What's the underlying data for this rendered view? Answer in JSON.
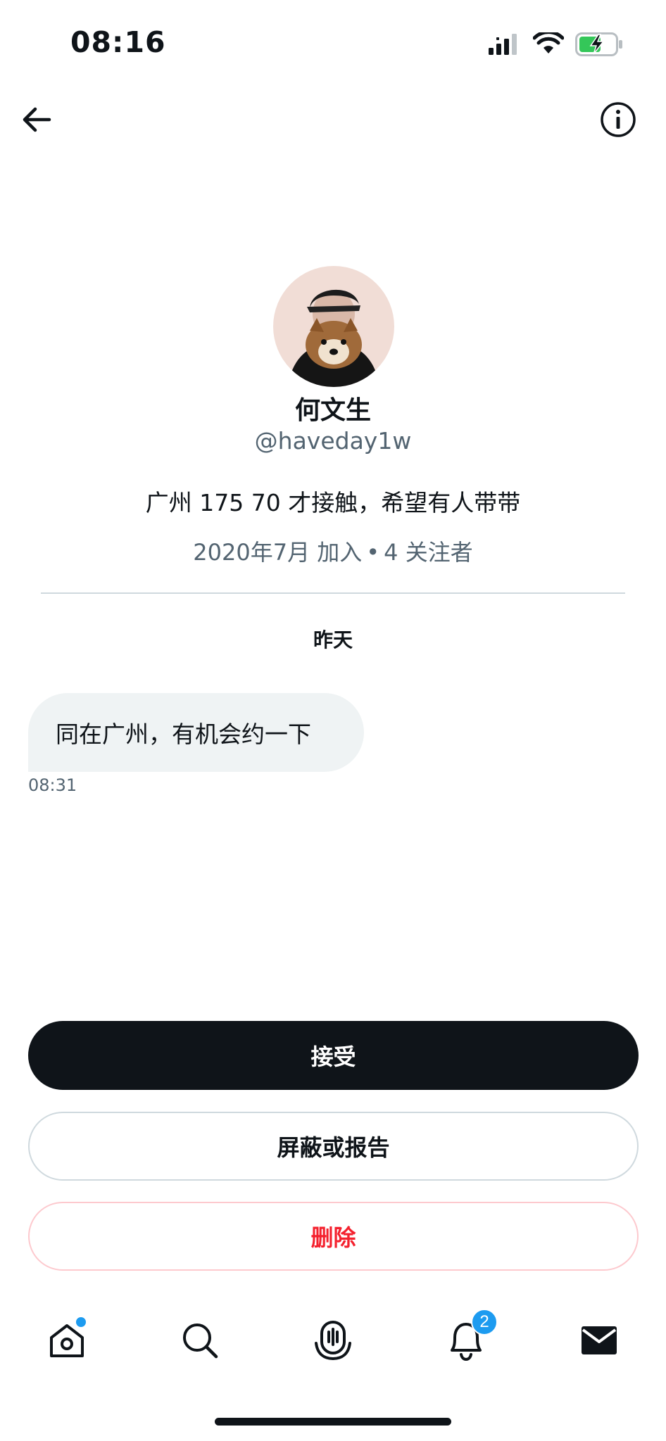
{
  "status_bar": {
    "time": "08:16"
  },
  "profile": {
    "name": "何文生",
    "handle": "@haveday1w",
    "bio": "广州 175 70 才接触，希望有人带带",
    "joined": "2020年7月 加入",
    "separator": "•",
    "followers": "4 关注者"
  },
  "conversation": {
    "date_label": "昨天",
    "messages": [
      {
        "text": "同在广州，有机会约一下",
        "time": "08:31"
      }
    ]
  },
  "actions": {
    "accept_label": "接受",
    "block_label": "屏蔽或报告",
    "delete_label": "删除"
  },
  "tab_bar": {
    "notification_count": "2"
  },
  "colors": {
    "primary_text": "#0f1419",
    "secondary_text": "#536471",
    "accent": "#1d9bf0",
    "danger": "#f4212e",
    "bubble_bg": "#eff3f4"
  }
}
